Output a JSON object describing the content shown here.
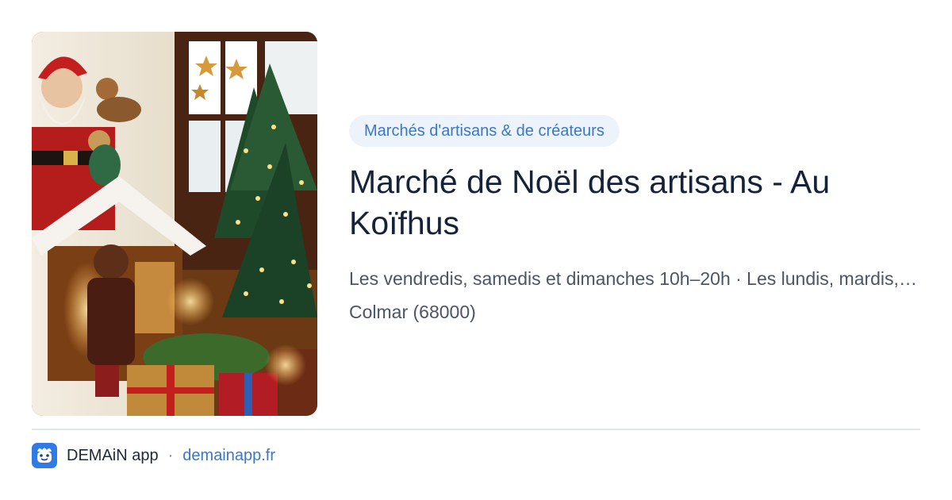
{
  "card": {
    "image_icon": "christmas-market-photo",
    "category": "Marchés d'artisans & de créateurs",
    "title": "Marché de Noël des artisans - Au Koïfhus",
    "schedule": "Les vendredis, samedis et dimanches 10h–20h · Les lundis, mardis, mercredis et jeudis",
    "location": "Colmar (68000)"
  },
  "footer": {
    "logo_icon": "demain-app-logo-icon",
    "app_name": "DEMAiN app",
    "separator": "·",
    "domain": "demainapp.fr"
  },
  "colors": {
    "pill_background": "#edf3fb",
    "accent": "#3a77c6",
    "title": "#152238",
    "body_text": "#4b5565",
    "divider": "#e3e8ee"
  }
}
